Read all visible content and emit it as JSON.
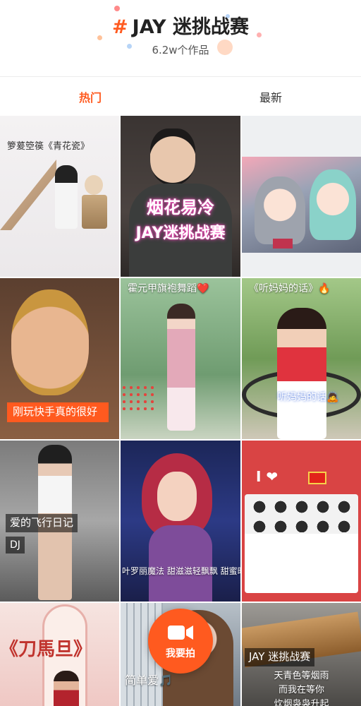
{
  "header": {
    "hashtag": "#",
    "title": "JAY 迷挑战赛",
    "works_count": "6.2w个作品"
  },
  "tabs": [
    {
      "label": "热门",
      "active": true
    },
    {
      "label": "最新",
      "active": false
    }
  ],
  "videos": [
    {
      "caption": "箩萲箜篌《青花瓷》"
    },
    {
      "overlay_line1": "烟花易冷",
      "overlay_line2": "JAY迷挑战赛"
    },
    {
      "caption": ""
    },
    {
      "caption": "刚玩快手真的很好"
    },
    {
      "caption": "霍元甲旗袍舞蹈❤️"
    },
    {
      "caption": "《听妈妈的话》🔥",
      "overlay": "听妈妈的话🙇"
    },
    {
      "caption": "爱的飞行日记",
      "tag": "DJ"
    },
    {
      "caption": "叶罗丽魔法  甜滋滋轻飘飘  甜蜜时刻"
    },
    {
      "caption": "",
      "overlay_icon": "I ❤"
    },
    {
      "caption": "《刀馬旦》"
    },
    {
      "caption": "简单爱🎵"
    },
    {
      "caption": "JAY 迷挑战赛",
      "lyrics": [
        "天青色等烟雨",
        "而我在等你",
        "炊烟袅袅升起"
      ]
    }
  ],
  "record_button": {
    "label": "我要拍",
    "icon": "camera-icon"
  },
  "colors": {
    "accent": "#ff5a1f"
  }
}
